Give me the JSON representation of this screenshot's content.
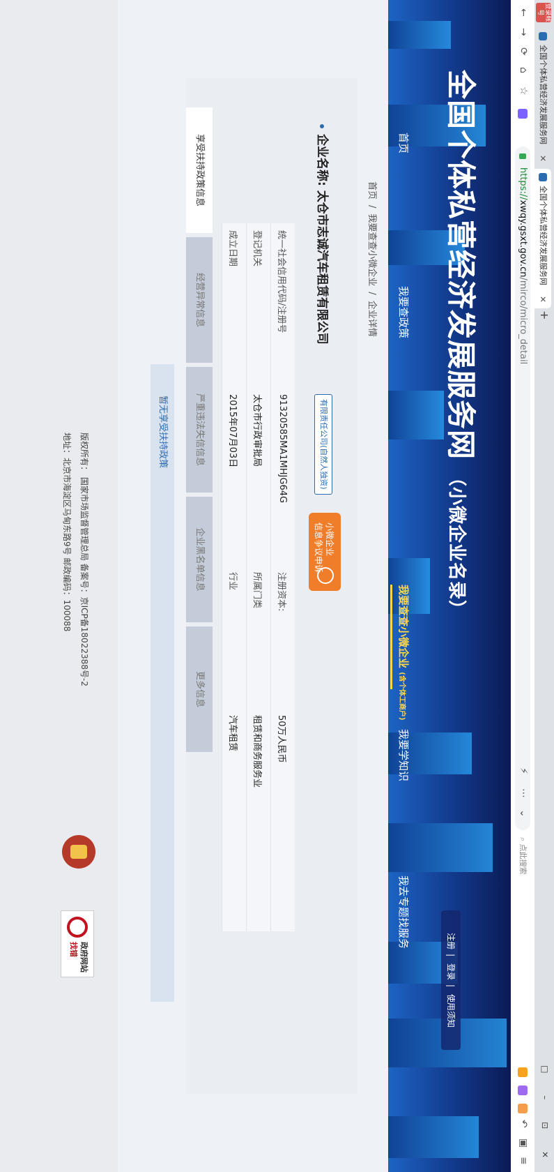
{
  "browser": {
    "user_badge": "登录帐号",
    "tabs": [
      {
        "title": "全国个体私营经济发展服务网",
        "active": false
      },
      {
        "title": "全国个体私营经济发展服务网",
        "active": true
      }
    ],
    "new_tab": "+",
    "window_controls": "□ – ⊡ ✕",
    "url_protocol": "https://",
    "url_host": "xwqy.gsxt.gov.cn",
    "url_path": "/mirco/micro_detail",
    "search_placeholder": "点此搜索",
    "nav_icons": [
      "back-icon",
      "forward-icon",
      "refresh-icon",
      "home-icon",
      "star-icon"
    ]
  },
  "header": {
    "top_links": [
      "注册",
      "登录",
      "使用须知"
    ],
    "title": "全国个体私营经济发展服务网",
    "subtitle": "（小微企业名录）",
    "nav": [
      {
        "label": "首页",
        "active": false
      },
      {
        "label": "我要查政策",
        "active": false
      },
      {
        "label": "我要查查小微企业",
        "note": "(含个体工商户)",
        "active": true
      },
      {
        "label": "我要学知识",
        "active": false
      },
      {
        "label": "我去专题找服务",
        "active": false
      }
    ]
  },
  "breadcrumb": [
    "首页",
    "/",
    "我要查查小微企业",
    "/",
    "企业详情"
  ],
  "company": {
    "name_label": "企业名称:",
    "name": "太仓市志诚汽车租赁有限公司",
    "type_badge": "有限责任公司(自然人独资)",
    "dispute_button": [
      "小微企业",
      "信息争议申诉"
    ],
    "info_rows": [
      {
        "label1": "统一社会信用代码/注册号",
        "value1": "91320585MA1MHJG64G",
        "label2": "注册资本:",
        "value2": "50万人民币"
      },
      {
        "label1": "登记机关",
        "value1": "太仓市行政审批局",
        "label2": "所属门类",
        "value2": "租赁和商务服务业"
      },
      {
        "label1": "成立日期",
        "value1": "2015年07月03日",
        "label2": "行业",
        "value2": "汽车租赁"
      }
    ]
  },
  "tabs": [
    {
      "label": "享受扶持政策信息",
      "active": true
    },
    {
      "label": "经营异常信息",
      "active": false
    },
    {
      "label": "严重违法失信信息",
      "active": false
    },
    {
      "label": "企业黑名单信息",
      "active": false
    },
    {
      "label": "更多信息",
      "active": false
    }
  ],
  "policy_empty": "暂无享受扶持政策",
  "footer": {
    "gov_text_1": "政府网站",
    "gov_text_2": "找错",
    "copyright": "版权所有：  国家市场监督管理总局  备案号：京ICP备18022388号-2",
    "address": "地址：北京市海淀区马甸东路9号 邮政编码：100088"
  }
}
